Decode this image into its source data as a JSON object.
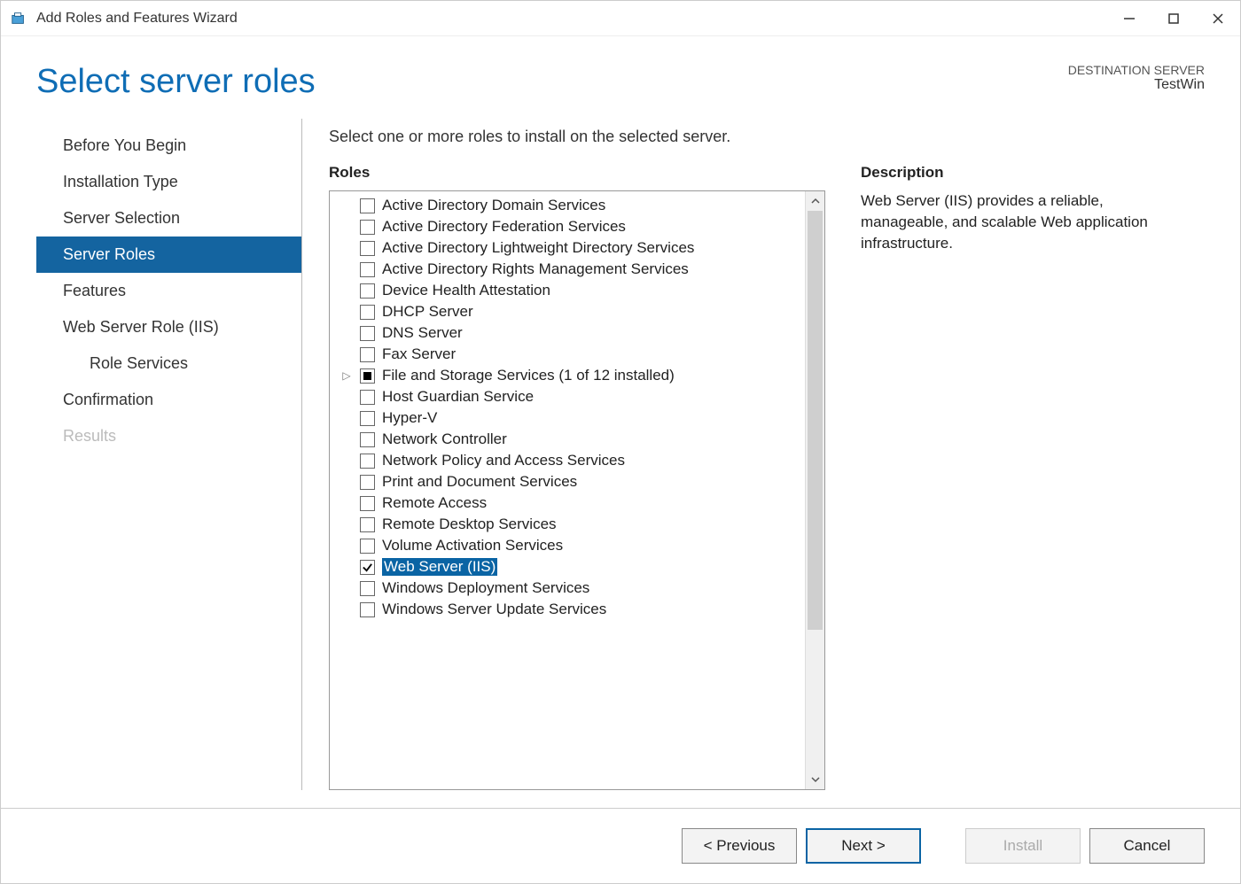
{
  "window": {
    "title": "Add Roles and Features Wizard"
  },
  "header": {
    "title": "Select server roles",
    "destination_label": "DESTINATION SERVER",
    "destination_value": "TestWin"
  },
  "sidebar": {
    "items": [
      {
        "label": "Before You Begin",
        "state": "normal"
      },
      {
        "label": "Installation Type",
        "state": "normal"
      },
      {
        "label": "Server Selection",
        "state": "normal"
      },
      {
        "label": "Server Roles",
        "state": "selected"
      },
      {
        "label": "Features",
        "state": "normal"
      },
      {
        "label": "Web Server Role (IIS)",
        "state": "normal"
      },
      {
        "label": "Role Services",
        "state": "normal",
        "sub": true
      },
      {
        "label": "Confirmation",
        "state": "normal"
      },
      {
        "label": "Results",
        "state": "disabled"
      }
    ]
  },
  "main": {
    "instruction": "Select one or more roles to install on the selected server.",
    "roles_label": "Roles",
    "description_label": "Description",
    "description_text": "Web Server (IIS) provides a reliable, manageable, and scalable Web application infrastructure.",
    "roles": [
      {
        "label": "Active Directory Domain Services",
        "check": "unchecked"
      },
      {
        "label": "Active Directory Federation Services",
        "check": "unchecked"
      },
      {
        "label": "Active Directory Lightweight Directory Services",
        "check": "unchecked"
      },
      {
        "label": "Active Directory Rights Management Services",
        "check": "unchecked"
      },
      {
        "label": "Device Health Attestation",
        "check": "unchecked"
      },
      {
        "label": "DHCP Server",
        "check": "unchecked"
      },
      {
        "label": "DNS Server",
        "check": "unchecked"
      },
      {
        "label": "Fax Server",
        "check": "unchecked"
      },
      {
        "label": "File and Storage Services (1 of 12 installed)",
        "check": "partial",
        "expandable": true
      },
      {
        "label": "Host Guardian Service",
        "check": "unchecked"
      },
      {
        "label": "Hyper-V",
        "check": "unchecked"
      },
      {
        "label": "Network Controller",
        "check": "unchecked"
      },
      {
        "label": "Network Policy and Access Services",
        "check": "unchecked"
      },
      {
        "label": "Print and Document Services",
        "check": "unchecked"
      },
      {
        "label": "Remote Access",
        "check": "unchecked"
      },
      {
        "label": "Remote Desktop Services",
        "check": "unchecked"
      },
      {
        "label": "Volume Activation Services",
        "check": "unchecked"
      },
      {
        "label": "Web Server (IIS)",
        "check": "checked",
        "selected": true
      },
      {
        "label": "Windows Deployment Services",
        "check": "unchecked"
      },
      {
        "label": "Windows Server Update Services",
        "check": "unchecked"
      }
    ]
  },
  "footer": {
    "previous": "< Previous",
    "next": "Next >",
    "install": "Install",
    "cancel": "Cancel"
  }
}
